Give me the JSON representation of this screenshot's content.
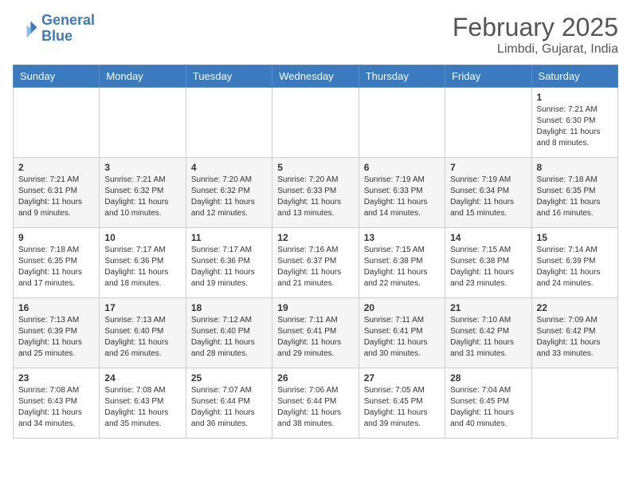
{
  "logo": {
    "line1": "General",
    "line2": "Blue"
  },
  "title": "February 2025",
  "location": "Limbdi, Gujarat, India",
  "weekdays": [
    "Sunday",
    "Monday",
    "Tuesday",
    "Wednesday",
    "Thursday",
    "Friday",
    "Saturday"
  ],
  "weeks": [
    [
      {
        "day": "",
        "info": ""
      },
      {
        "day": "",
        "info": ""
      },
      {
        "day": "",
        "info": ""
      },
      {
        "day": "",
        "info": ""
      },
      {
        "day": "",
        "info": ""
      },
      {
        "day": "",
        "info": ""
      },
      {
        "day": "1",
        "info": "Sunrise: 7:21 AM\nSunset: 6:30 PM\nDaylight: 11 hours\nand 8 minutes."
      }
    ],
    [
      {
        "day": "2",
        "info": "Sunrise: 7:21 AM\nSunset: 6:31 PM\nDaylight: 11 hours\nand 9 minutes."
      },
      {
        "day": "3",
        "info": "Sunrise: 7:21 AM\nSunset: 6:32 PM\nDaylight: 11 hours\nand 10 minutes."
      },
      {
        "day": "4",
        "info": "Sunrise: 7:20 AM\nSunset: 6:32 PM\nDaylight: 11 hours\nand 12 minutes."
      },
      {
        "day": "5",
        "info": "Sunrise: 7:20 AM\nSunset: 6:33 PM\nDaylight: 11 hours\nand 13 minutes."
      },
      {
        "day": "6",
        "info": "Sunrise: 7:19 AM\nSunset: 6:33 PM\nDaylight: 11 hours\nand 14 minutes."
      },
      {
        "day": "7",
        "info": "Sunrise: 7:19 AM\nSunset: 6:34 PM\nDaylight: 11 hours\nand 15 minutes."
      },
      {
        "day": "8",
        "info": "Sunrise: 7:18 AM\nSunset: 6:35 PM\nDaylight: 11 hours\nand 16 minutes."
      }
    ],
    [
      {
        "day": "9",
        "info": "Sunrise: 7:18 AM\nSunset: 6:35 PM\nDaylight: 11 hours\nand 17 minutes."
      },
      {
        "day": "10",
        "info": "Sunrise: 7:17 AM\nSunset: 6:36 PM\nDaylight: 11 hours\nand 18 minutes."
      },
      {
        "day": "11",
        "info": "Sunrise: 7:17 AM\nSunset: 6:36 PM\nDaylight: 11 hours\nand 19 minutes."
      },
      {
        "day": "12",
        "info": "Sunrise: 7:16 AM\nSunset: 6:37 PM\nDaylight: 11 hours\nand 21 minutes."
      },
      {
        "day": "13",
        "info": "Sunrise: 7:15 AM\nSunset: 6:38 PM\nDaylight: 11 hours\nand 22 minutes."
      },
      {
        "day": "14",
        "info": "Sunrise: 7:15 AM\nSunset: 6:38 PM\nDaylight: 11 hours\nand 23 minutes."
      },
      {
        "day": "15",
        "info": "Sunrise: 7:14 AM\nSunset: 6:39 PM\nDaylight: 11 hours\nand 24 minutes."
      }
    ],
    [
      {
        "day": "16",
        "info": "Sunrise: 7:13 AM\nSunset: 6:39 PM\nDaylight: 11 hours\nand 25 minutes."
      },
      {
        "day": "17",
        "info": "Sunrise: 7:13 AM\nSunset: 6:40 PM\nDaylight: 11 hours\nand 26 minutes."
      },
      {
        "day": "18",
        "info": "Sunrise: 7:12 AM\nSunset: 6:40 PM\nDaylight: 11 hours\nand 28 minutes."
      },
      {
        "day": "19",
        "info": "Sunrise: 7:11 AM\nSunset: 6:41 PM\nDaylight: 11 hours\nand 29 minutes."
      },
      {
        "day": "20",
        "info": "Sunrise: 7:11 AM\nSunset: 6:41 PM\nDaylight: 11 hours\nand 30 minutes."
      },
      {
        "day": "21",
        "info": "Sunrise: 7:10 AM\nSunset: 6:42 PM\nDaylight: 11 hours\nand 31 minutes."
      },
      {
        "day": "22",
        "info": "Sunrise: 7:09 AM\nSunset: 6:42 PM\nDaylight: 11 hours\nand 33 minutes."
      }
    ],
    [
      {
        "day": "23",
        "info": "Sunrise: 7:08 AM\nSunset: 6:43 PM\nDaylight: 11 hours\nand 34 minutes."
      },
      {
        "day": "24",
        "info": "Sunrise: 7:08 AM\nSunset: 6:43 PM\nDaylight: 11 hours\nand 35 minutes."
      },
      {
        "day": "25",
        "info": "Sunrise: 7:07 AM\nSunset: 6:44 PM\nDaylight: 11 hours\nand 36 minutes."
      },
      {
        "day": "26",
        "info": "Sunrise: 7:06 AM\nSunset: 6:44 PM\nDaylight: 11 hours\nand 38 minutes."
      },
      {
        "day": "27",
        "info": "Sunrise: 7:05 AM\nSunset: 6:45 PM\nDaylight: 11 hours\nand 39 minutes."
      },
      {
        "day": "28",
        "info": "Sunrise: 7:04 AM\nSunset: 6:45 PM\nDaylight: 11 hours\nand 40 minutes."
      },
      {
        "day": "",
        "info": ""
      }
    ]
  ]
}
